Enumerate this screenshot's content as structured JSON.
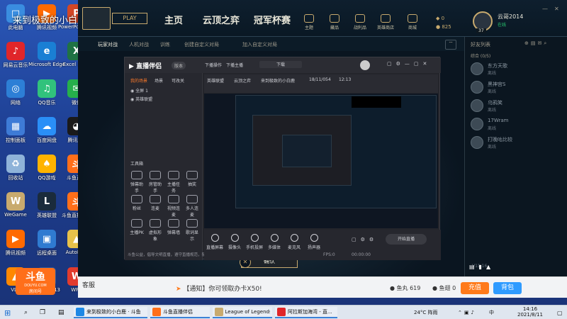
{
  "desktop": {
    "icons": [
      {
        "label": "此电脑",
        "color": "#3a8de0",
        "glyph": "□"
      },
      {
        "label": "腾讯视频",
        "color": "#ff6a00",
        "glyph": "▶"
      },
      {
        "label": "PowerPoint 2013",
        "color": "#d24726",
        "glyph": "P"
      },
      {
        "label": "网易云音乐",
        "color": "#e0262a",
        "glyph": "♪"
      },
      {
        "label": "Microsoft Edge",
        "color": "#1a7fd4",
        "glyph": "e"
      },
      {
        "label": "Excel 2013",
        "color": "#1f7244",
        "glyph": "X"
      },
      {
        "label": "网络",
        "color": "#2d7fd6",
        "glyph": "◎"
      },
      {
        "label": "QQ音乐",
        "color": "#31c27c",
        "glyph": "♫"
      },
      {
        "label": "微信",
        "color": "#26b04b",
        "glyph": "✉"
      },
      {
        "label": "控制面板",
        "color": "#3e7bd6",
        "glyph": "▦"
      },
      {
        "label": "百度网盘",
        "color": "#2a8ff7",
        "glyph": "☁"
      },
      {
        "label": "腾讯QQ",
        "color": "#1a1a1a",
        "glyph": "◕"
      },
      {
        "label": "回收站",
        "color": "#8fb3d9",
        "glyph": "♻"
      },
      {
        "label": "QQ游戏",
        "color": "#ffb300",
        "glyph": "♠"
      },
      {
        "label": "斗鱼直播",
        "color": "#ff6f1a",
        "glyph": "斗"
      },
      {
        "label": "WeGame",
        "color": "#c8aa6e",
        "glyph": "W"
      },
      {
        "label": "英雄联盟",
        "color": "#1a2b3c",
        "glyph": "L"
      },
      {
        "label": "斗鱼直播伴侣",
        "color": "#ff6f1a",
        "glyph": "斗"
      },
      {
        "label": "腾讯视频",
        "color": "#ff6a00",
        "glyph": "▶"
      },
      {
        "label": "远程桌面",
        "color": "#2f7bd1",
        "glyph": "▣"
      },
      {
        "label": "AutoPlay",
        "color": "#e7c14a",
        "glyph": "▲"
      },
      {
        "label": "VLC",
        "color": "#ff8800",
        "glyph": "▲"
      },
      {
        "label": "Word 2013",
        "color": "#2b579a",
        "glyph": "W"
      },
      {
        "label": "WPS",
        "color": "#e23b2e",
        "glyph": "W"
      }
    ]
  },
  "overlay_title": "来到极致的小白鹿",
  "lol": {
    "play_button": "PLAY",
    "nav": [
      "主页",
      "云顶之弈",
      "冠军杯赛"
    ],
    "top_icons": [
      "主题",
      "藏品",
      "战利品",
      "英雄商店",
      "商城"
    ],
    "currency": {
      "be": "0",
      "rp": "825"
    },
    "username": "云哥2014",
    "status": "在线",
    "level": "37",
    "subnav": [
      "玩家对战",
      "人机对战",
      "训练",
      "创建自定义对局",
      "加入自定义对局"
    ],
    "friends_title": "好友列表",
    "friends_group": "综合 (0/5)",
    "friends": [
      {
        "name": "东方天歌",
        "status": "离线"
      },
      {
        "name": "黑神宫S",
        "status": "离线"
      },
      {
        "name": "乌鸦笑",
        "status": "离线"
      },
      {
        "name": "17Wram",
        "status": "离线"
      },
      {
        "name": "打晚咕比较",
        "status": "离线"
      }
    ],
    "confirm_button": "确认",
    "version": "V11.16"
  },
  "douyu": {
    "app_name": "直播伴侣",
    "tabs": [
      "我的场景",
      "场景",
      "可改关"
    ],
    "scene_items": [
      "全屏 1",
      "英雄联盟"
    ],
    "tools_title": "工具箱",
    "tools": [
      "弹幕助手",
      "房管助手",
      "主播任务",
      "抽奖",
      "粉丝",
      "连麦",
      "视频连麦",
      "多人连麦",
      "主播PK",
      "虚拟形象",
      "弹幕墙",
      "歌词显示",
      "多功能",
      "商品"
    ],
    "header_items": [
      "下播操作",
      "下播主播",
      "下载"
    ],
    "toolbar_items": [
      "英雄联盟",
      "云顶之弈",
      "来到极致的小白鹿",
      "18/11/054",
      "12:13"
    ],
    "bottom_tools": [
      "直播屏幕",
      "摄像头",
      "手机投屏",
      "多媒体",
      "麦克风",
      "扬声器"
    ],
    "start_button": "开始直播",
    "status_text": "斗鱼公益，倡导文明直播，遵守直播规范，禁止低俗内容",
    "fps": "FPS:0",
    "timer": "00:00:00"
  },
  "chatbar": {
    "left_label": "客服",
    "notice": "【通知】你可领取办卡X50!",
    "fish_balls": "鱼丸 619",
    "fish_wing": "鱼翅 0",
    "recharge": "充值",
    "backpack": "背包"
  },
  "watermark": {
    "brand": "斗鱼",
    "sub": "DOUYU.COM",
    "room": "房间号"
  },
  "taskbar": {
    "items": [
      {
        "label": "来到极致的小白鹿 · 斗鱼",
        "color": "#1e88e5"
      },
      {
        "label": "斗鱼直播伴侣",
        "color": "#ff6f1a"
      },
      {
        "label": "League of Legends",
        "color": "#c8aa6e"
      },
      {
        "label": "阿拉斯加海湾 - 直...",
        "color": "#e0262a"
      }
    ],
    "weather": "24°C 阵雨",
    "ime": "中",
    "time": "14:16",
    "date": "2021/8/11"
  }
}
